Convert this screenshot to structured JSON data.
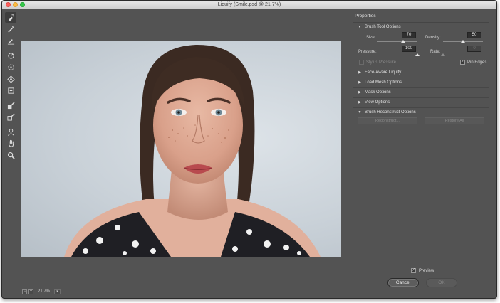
{
  "window": {
    "title": "Liquify (Smile.psd @ 21.7%)"
  },
  "toolbar": {
    "tools": [
      {
        "name": "forward-warp-tool",
        "icon": "forward-warp-icon"
      },
      {
        "name": "reconstruct-tool",
        "icon": "reconstruct-icon"
      },
      {
        "name": "smooth-tool",
        "icon": "smooth-icon"
      },
      {
        "name": "twirl-clockwise-tool",
        "icon": "twirl-icon"
      },
      {
        "name": "pucker-tool",
        "icon": "pucker-icon"
      },
      {
        "name": "bloat-tool",
        "icon": "bloat-icon"
      },
      {
        "name": "push-left-tool",
        "icon": "push-left-icon"
      },
      {
        "name": "freeze-mask-tool",
        "icon": "freeze-mask-icon"
      },
      {
        "name": "thaw-mask-tool",
        "icon": "thaw-mask-icon"
      },
      {
        "name": "face-tool",
        "icon": "face-icon"
      },
      {
        "name": "hand-tool",
        "icon": "hand-icon"
      },
      {
        "name": "zoom-tool",
        "icon": "zoom-icon"
      }
    ]
  },
  "status": {
    "zoom_out": "−",
    "zoom_in": "+",
    "zoom": "21.7%",
    "dropdown": "▾"
  },
  "properties": {
    "title": "Properties",
    "brush_tool_options": {
      "label": "Brush Tool Options",
      "size_label": "Size:",
      "size": "70",
      "size_level": 0.65,
      "density_label": "Density:",
      "density": "50",
      "density_level": 0.5,
      "pressure_label": "Pressure:",
      "pressure": "100",
      "pressure_level": 1.0,
      "rate_label": "Rate:",
      "rate": "0",
      "rate_level": 0.0,
      "stylus_label": "Stylus Pressure",
      "pin_edges_label": "Pin Edges",
      "pin_edges_checked": true
    },
    "face_aware": {
      "label": "Face-Aware Liquify"
    },
    "load_mesh": {
      "label": "Load Mesh Options"
    },
    "mask": {
      "label": "Mask Options"
    },
    "view": {
      "label": "View Options"
    },
    "reconstruct": {
      "label": "Brush Reconstruct Options",
      "reconstruct_btn": "Reconstruct...",
      "restore_all_btn": "Restore All"
    }
  },
  "footer": {
    "preview_label": "Preview",
    "preview_checked": true,
    "cancel_label": "Cancel",
    "ok_label": "OK"
  },
  "colors": {
    "window_bg": "#535353",
    "panel_text": "#d6d6d6",
    "field_bg": "#2f2f2f"
  }
}
